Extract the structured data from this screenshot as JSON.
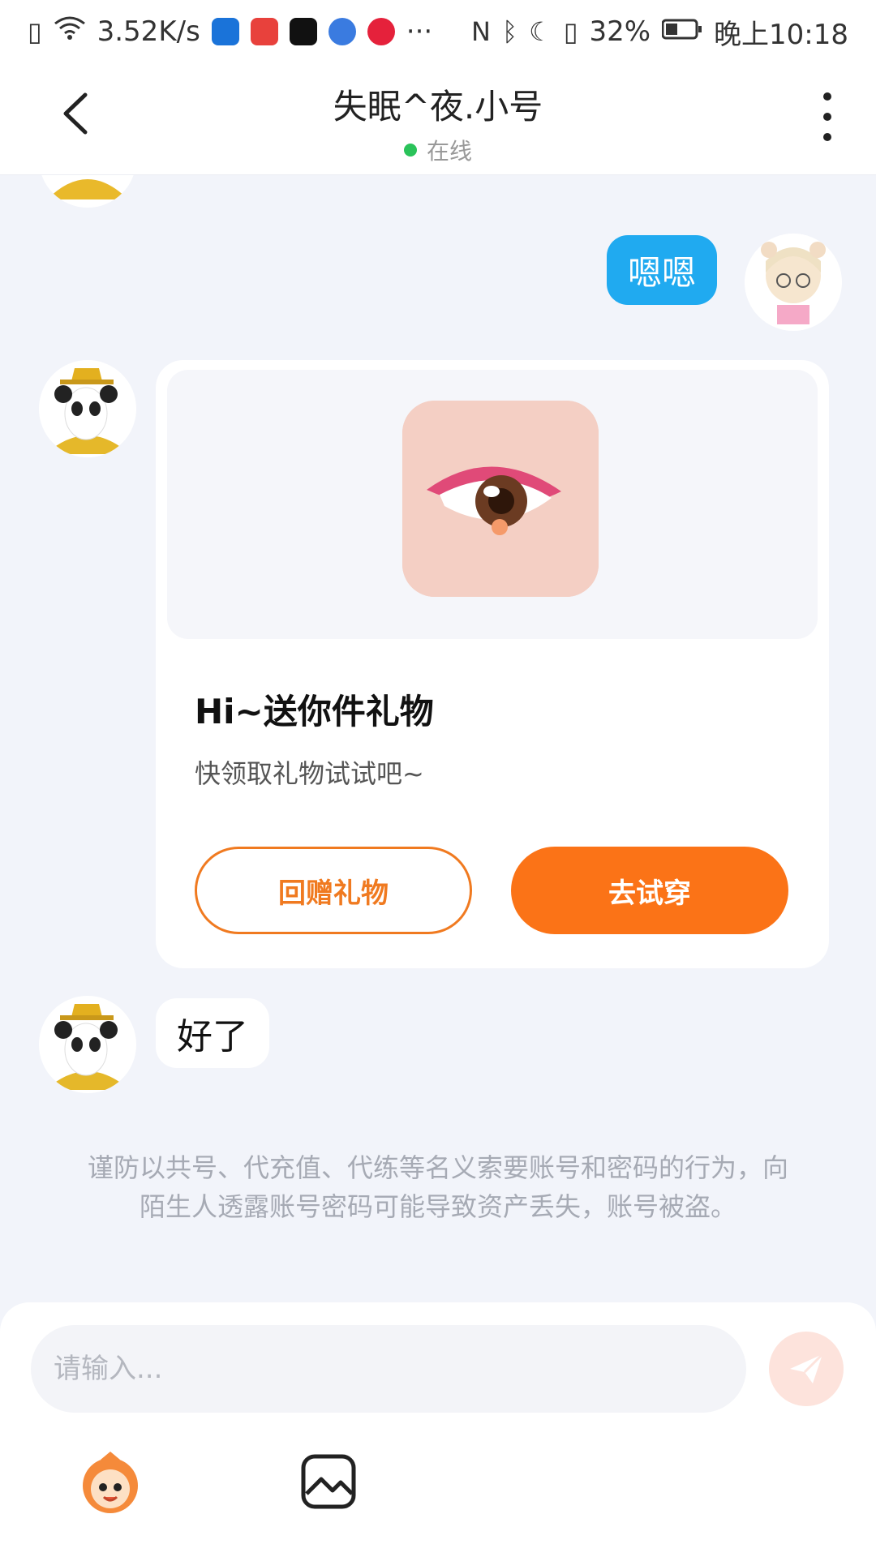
{
  "status_bar": {
    "net_speed": "3.52K/s",
    "battery": "32%",
    "time": "晚上10:18",
    "more": "···"
  },
  "header": {
    "title": "失眠^夜.小号",
    "status": "在线"
  },
  "messages": {
    "outgoing_text": "嗯嗯",
    "incoming_text": "好了"
  },
  "gift_card": {
    "title": "Hi~送你件礼物",
    "subtitle": "快领取礼物试试吧~",
    "return_gift_label": "回赠礼物",
    "try_on_label": "去试穿"
  },
  "notice": "谨防以共号、代充值、代练等名义索要账号和密码的行为，向陌生人透露账号密码可能导致资产丢失，账号被盗。",
  "input": {
    "placeholder": "请输入..."
  },
  "colors": {
    "accent_orange": "#fb7317",
    "bubble_blue": "#20aaf0",
    "online_green": "#2ac35a"
  },
  "icons": {
    "back": "chevron-left-icon",
    "more": "more-vertical-icon",
    "send": "send-icon",
    "emoji": "emoji-mascot-icon",
    "image": "image-icon"
  }
}
